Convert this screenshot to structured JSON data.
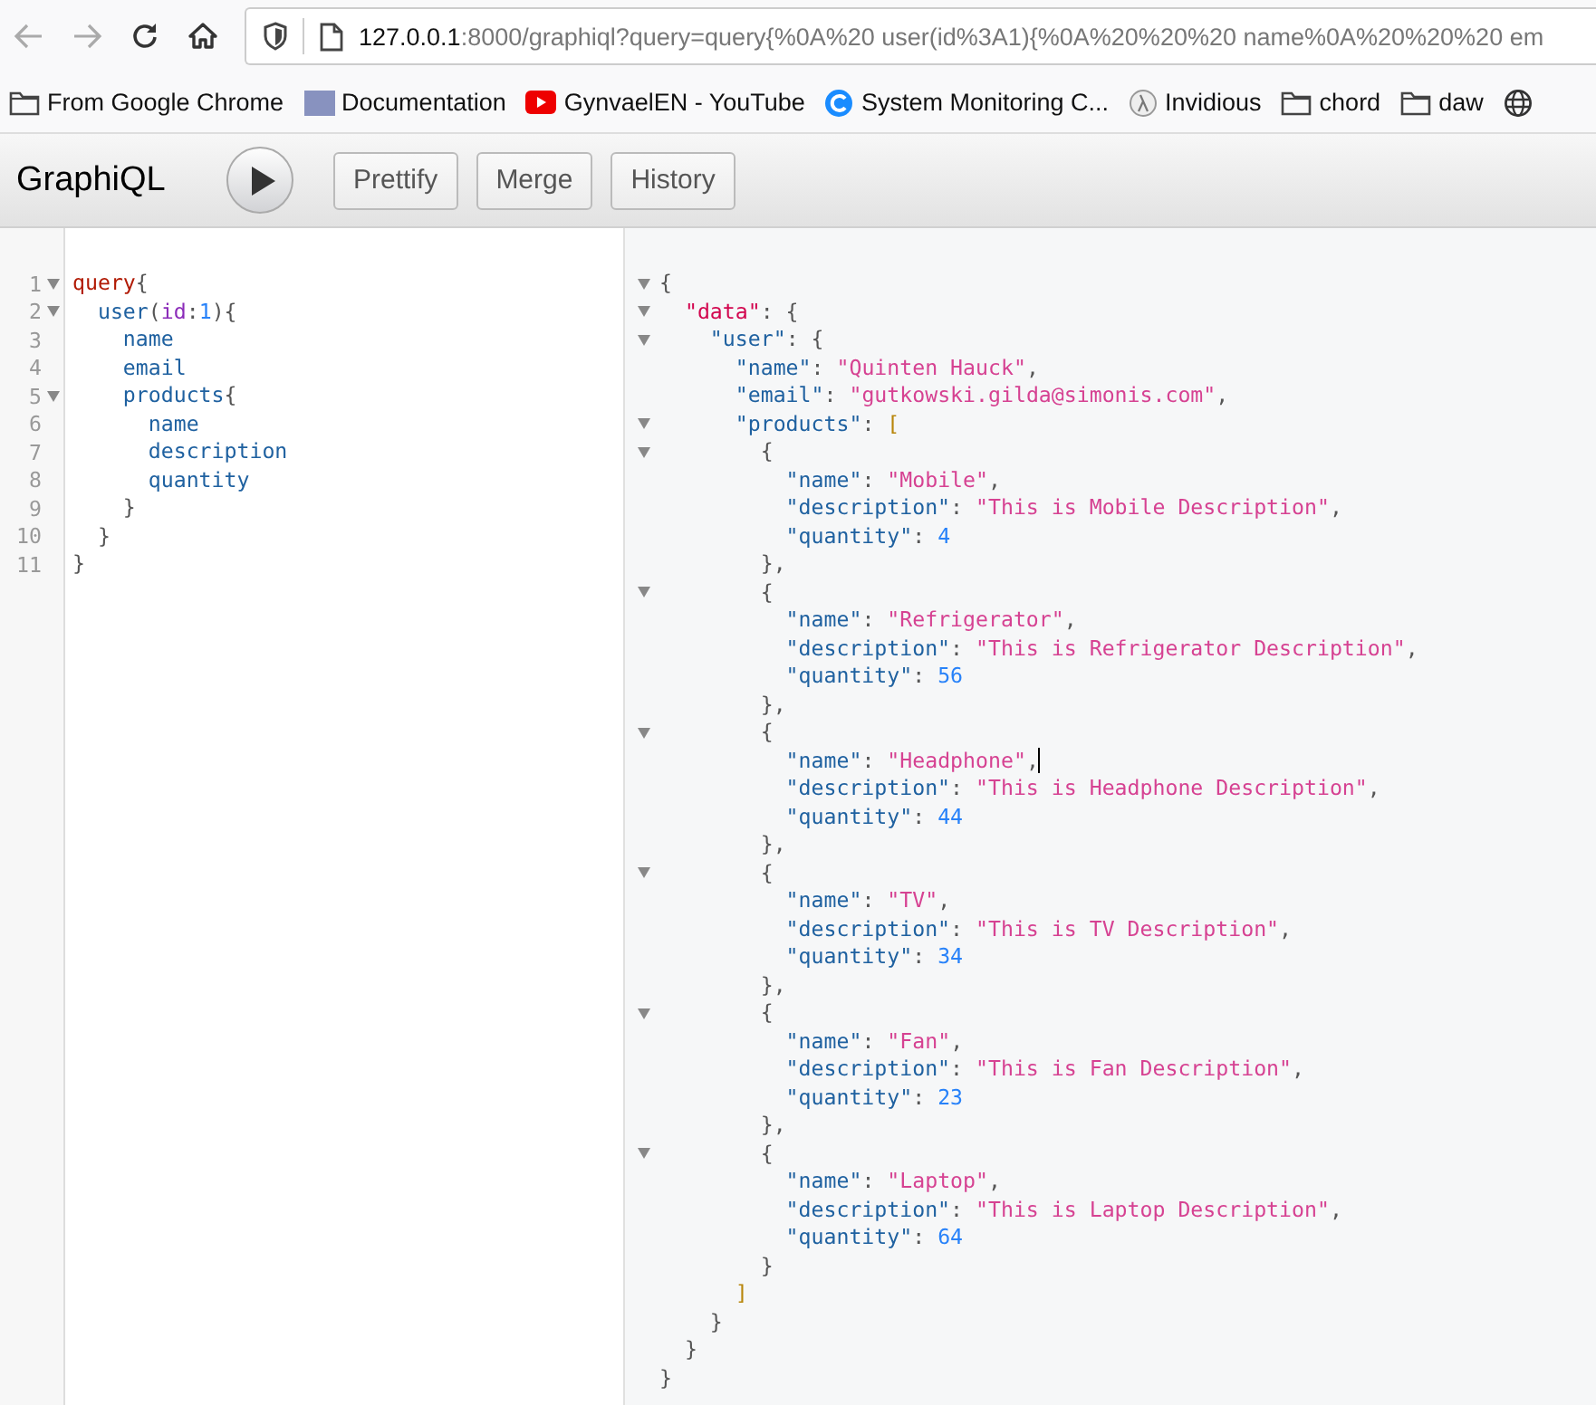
{
  "browser": {
    "back_disabled": true,
    "forward_disabled": true,
    "url_host": "127.0.0.1",
    "url_rest": ":8000/graphiql?query=query{%0A%20 user(id%3A1){%0A%20%20%20 name%0A%20%20%20 em"
  },
  "bookmarks": [
    {
      "kind": "folder",
      "label": "From Google Chrome"
    },
    {
      "kind": "php",
      "label": "Documentation"
    },
    {
      "kind": "video",
      "label": "GynvaelEN - YouTube"
    },
    {
      "kind": "ring",
      "label": "System Monitoring C..."
    },
    {
      "kind": "lambda",
      "label": "Invidious"
    },
    {
      "kind": "folder",
      "label": "chord"
    },
    {
      "kind": "folder",
      "label": "daw"
    },
    {
      "kind": "globe"
    }
  ],
  "toolbar": {
    "title": "GraphiQL",
    "buttons": [
      "Prettify",
      "Merge",
      "History"
    ]
  },
  "query_editor": {
    "lines": [
      {
        "number": "1",
        "foldable": true,
        "tokens": [
          {
            "kind": "keyword",
            "text": "query"
          },
          {
            "kind": "punct",
            "text": "{"
          }
        ]
      },
      {
        "number": "2",
        "foldable": true,
        "tokens": [
          {
            "kind": "field",
            "text": "  user"
          },
          {
            "kind": "punct",
            "text": "("
          },
          {
            "kind": "attr",
            "text": "id"
          },
          {
            "kind": "punct",
            "text": ":"
          },
          {
            "kind": "number",
            "text": "1"
          },
          {
            "kind": "punct",
            "text": "){"
          }
        ]
      },
      {
        "number": "3",
        "foldable": false,
        "tokens": [
          {
            "kind": "field",
            "text": "    name"
          }
        ]
      },
      {
        "number": "4",
        "foldable": false,
        "tokens": [
          {
            "kind": "field",
            "text": "    email"
          }
        ]
      },
      {
        "number": "5",
        "foldable": true,
        "tokens": [
          {
            "kind": "field",
            "text": "    products"
          },
          {
            "kind": "punct",
            "text": "{"
          }
        ]
      },
      {
        "number": "6",
        "foldable": false,
        "tokens": [
          {
            "kind": "field",
            "text": "      name"
          }
        ]
      },
      {
        "number": "7",
        "foldable": false,
        "tokens": [
          {
            "kind": "field",
            "text": "      description"
          }
        ]
      },
      {
        "number": "8",
        "foldable": false,
        "tokens": [
          {
            "kind": "field",
            "text": "      quantity"
          }
        ]
      },
      {
        "number": "9",
        "foldable": false,
        "tokens": [
          {
            "kind": "punct",
            "text": "    }"
          }
        ]
      },
      {
        "number": "10",
        "foldable": false,
        "tokens": [
          {
            "kind": "punct",
            "text": "  }"
          }
        ]
      },
      {
        "number": "11",
        "foldable": false,
        "tokens": [
          {
            "kind": "punct",
            "text": "}"
          }
        ]
      }
    ]
  },
  "result_viewer": {
    "lines": [
      {
        "foldable": true,
        "tokens": [
          {
            "kind": "punct",
            "text": "{"
          }
        ]
      },
      {
        "foldable": true,
        "tokens": [
          {
            "kind": "rootkey",
            "text": "  \"data\""
          },
          {
            "kind": "punct",
            "text": ": {"
          }
        ]
      },
      {
        "foldable": true,
        "tokens": [
          {
            "kind": "key",
            "text": "    \"user\""
          },
          {
            "kind": "punct",
            "text": ": {"
          }
        ]
      },
      {
        "foldable": false,
        "tokens": [
          {
            "kind": "key",
            "text": "      \"name\""
          },
          {
            "kind": "punct",
            "text": ": "
          },
          {
            "kind": "string",
            "text": "\"Quinten Hauck\""
          },
          {
            "kind": "punct",
            "text": ","
          }
        ]
      },
      {
        "foldable": false,
        "tokens": [
          {
            "kind": "key",
            "text": "      \"email\""
          },
          {
            "kind": "punct",
            "text": ": "
          },
          {
            "kind": "string",
            "text": "\"gutkowski.gilda@simonis.com\""
          },
          {
            "kind": "punct",
            "text": ","
          }
        ]
      },
      {
        "foldable": true,
        "tokens": [
          {
            "kind": "key",
            "text": "      \"products\""
          },
          {
            "kind": "punct",
            "text": ": "
          },
          {
            "kind": "bracket",
            "text": "["
          }
        ]
      },
      {
        "foldable": true,
        "tokens": [
          {
            "kind": "punct",
            "text": "        {"
          }
        ]
      },
      {
        "foldable": false,
        "tokens": [
          {
            "kind": "key",
            "text": "          \"name\""
          },
          {
            "kind": "punct",
            "text": ": "
          },
          {
            "kind": "string",
            "text": "\"Mobile\""
          },
          {
            "kind": "punct",
            "text": ","
          }
        ]
      },
      {
        "foldable": false,
        "tokens": [
          {
            "kind": "key",
            "text": "          \"description\""
          },
          {
            "kind": "punct",
            "text": ": "
          },
          {
            "kind": "string",
            "text": "\"This is Mobile Description\""
          },
          {
            "kind": "punct",
            "text": ","
          }
        ]
      },
      {
        "foldable": false,
        "tokens": [
          {
            "kind": "key",
            "text": "          \"quantity\""
          },
          {
            "kind": "punct",
            "text": ": "
          },
          {
            "kind": "number",
            "text": "4"
          }
        ]
      },
      {
        "foldable": false,
        "tokens": [
          {
            "kind": "punct",
            "text": "        },"
          }
        ]
      },
      {
        "foldable": true,
        "tokens": [
          {
            "kind": "punct",
            "text": "        {"
          }
        ]
      },
      {
        "foldable": false,
        "tokens": [
          {
            "kind": "key",
            "text": "          \"name\""
          },
          {
            "kind": "punct",
            "text": ": "
          },
          {
            "kind": "string",
            "text": "\"Refrigerator\""
          },
          {
            "kind": "punct",
            "text": ","
          }
        ]
      },
      {
        "foldable": false,
        "tokens": [
          {
            "kind": "key",
            "text": "          \"description\""
          },
          {
            "kind": "punct",
            "text": ": "
          },
          {
            "kind": "string",
            "text": "\"This is Refrigerator Description\""
          },
          {
            "kind": "punct",
            "text": ","
          }
        ]
      },
      {
        "foldable": false,
        "tokens": [
          {
            "kind": "key",
            "text": "          \"quantity\""
          },
          {
            "kind": "punct",
            "text": ": "
          },
          {
            "kind": "number",
            "text": "56"
          }
        ]
      },
      {
        "foldable": false,
        "tokens": [
          {
            "kind": "punct",
            "text": "        },"
          }
        ]
      },
      {
        "foldable": true,
        "tokens": [
          {
            "kind": "punct",
            "text": "        {"
          }
        ]
      },
      {
        "foldable": false,
        "cursor": true,
        "tokens": [
          {
            "kind": "key",
            "text": "          \"name\""
          },
          {
            "kind": "punct",
            "text": ": "
          },
          {
            "kind": "string",
            "text": "\"Headphone\""
          },
          {
            "kind": "punct",
            "text": ","
          }
        ]
      },
      {
        "foldable": false,
        "tokens": [
          {
            "kind": "key",
            "text": "          \"description\""
          },
          {
            "kind": "punct",
            "text": ": "
          },
          {
            "kind": "string",
            "text": "\"This is Headphone Description\""
          },
          {
            "kind": "punct",
            "text": ","
          }
        ]
      },
      {
        "foldable": false,
        "tokens": [
          {
            "kind": "key",
            "text": "          \"quantity\""
          },
          {
            "kind": "punct",
            "text": ": "
          },
          {
            "kind": "number",
            "text": "44"
          }
        ]
      },
      {
        "foldable": false,
        "tokens": [
          {
            "kind": "punct",
            "text": "        },"
          }
        ]
      },
      {
        "foldable": true,
        "tokens": [
          {
            "kind": "punct",
            "text": "        {"
          }
        ]
      },
      {
        "foldable": false,
        "tokens": [
          {
            "kind": "key",
            "text": "          \"name\""
          },
          {
            "kind": "punct",
            "text": ": "
          },
          {
            "kind": "string",
            "text": "\"TV\""
          },
          {
            "kind": "punct",
            "text": ","
          }
        ]
      },
      {
        "foldable": false,
        "tokens": [
          {
            "kind": "key",
            "text": "          \"description\""
          },
          {
            "kind": "punct",
            "text": ": "
          },
          {
            "kind": "string",
            "text": "\"This is TV Description\""
          },
          {
            "kind": "punct",
            "text": ","
          }
        ]
      },
      {
        "foldable": false,
        "tokens": [
          {
            "kind": "key",
            "text": "          \"quantity\""
          },
          {
            "kind": "punct",
            "text": ": "
          },
          {
            "kind": "number",
            "text": "34"
          }
        ]
      },
      {
        "foldable": false,
        "tokens": [
          {
            "kind": "punct",
            "text": "        },"
          }
        ]
      },
      {
        "foldable": true,
        "tokens": [
          {
            "kind": "punct",
            "text": "        {"
          }
        ]
      },
      {
        "foldable": false,
        "tokens": [
          {
            "kind": "key",
            "text": "          \"name\""
          },
          {
            "kind": "punct",
            "text": ": "
          },
          {
            "kind": "string",
            "text": "\"Fan\""
          },
          {
            "kind": "punct",
            "text": ","
          }
        ]
      },
      {
        "foldable": false,
        "tokens": [
          {
            "kind": "key",
            "text": "          \"description\""
          },
          {
            "kind": "punct",
            "text": ": "
          },
          {
            "kind": "string",
            "text": "\"This is Fan Description\""
          },
          {
            "kind": "punct",
            "text": ","
          }
        ]
      },
      {
        "foldable": false,
        "tokens": [
          {
            "kind": "key",
            "text": "          \"quantity\""
          },
          {
            "kind": "punct",
            "text": ": "
          },
          {
            "kind": "number",
            "text": "23"
          }
        ]
      },
      {
        "foldable": false,
        "tokens": [
          {
            "kind": "punct",
            "text": "        },"
          }
        ]
      },
      {
        "foldable": true,
        "tokens": [
          {
            "kind": "punct",
            "text": "        {"
          }
        ]
      },
      {
        "foldable": false,
        "tokens": [
          {
            "kind": "key",
            "text": "          \"name\""
          },
          {
            "kind": "punct",
            "text": ": "
          },
          {
            "kind": "string",
            "text": "\"Laptop\""
          },
          {
            "kind": "punct",
            "text": ","
          }
        ]
      },
      {
        "foldable": false,
        "tokens": [
          {
            "kind": "key",
            "text": "          \"description\""
          },
          {
            "kind": "punct",
            "text": ": "
          },
          {
            "kind": "string",
            "text": "\"This is Laptop Description\""
          },
          {
            "kind": "punct",
            "text": ","
          }
        ]
      },
      {
        "foldable": false,
        "tokens": [
          {
            "kind": "key",
            "text": "          \"quantity\""
          },
          {
            "kind": "punct",
            "text": ": "
          },
          {
            "kind": "number",
            "text": "64"
          }
        ]
      },
      {
        "foldable": false,
        "tokens": [
          {
            "kind": "punct",
            "text": "        }"
          }
        ]
      },
      {
        "foldable": false,
        "tokens": [
          {
            "kind": "bracket",
            "text": "      ]"
          }
        ]
      },
      {
        "foldable": false,
        "tokens": [
          {
            "kind": "punct",
            "text": "    }"
          }
        ]
      },
      {
        "foldable": false,
        "tokens": [
          {
            "kind": "punct",
            "text": "  }"
          }
        ]
      },
      {
        "foldable": false,
        "tokens": [
          {
            "kind": "punct",
            "text": "}"
          }
        ]
      }
    ]
  }
}
